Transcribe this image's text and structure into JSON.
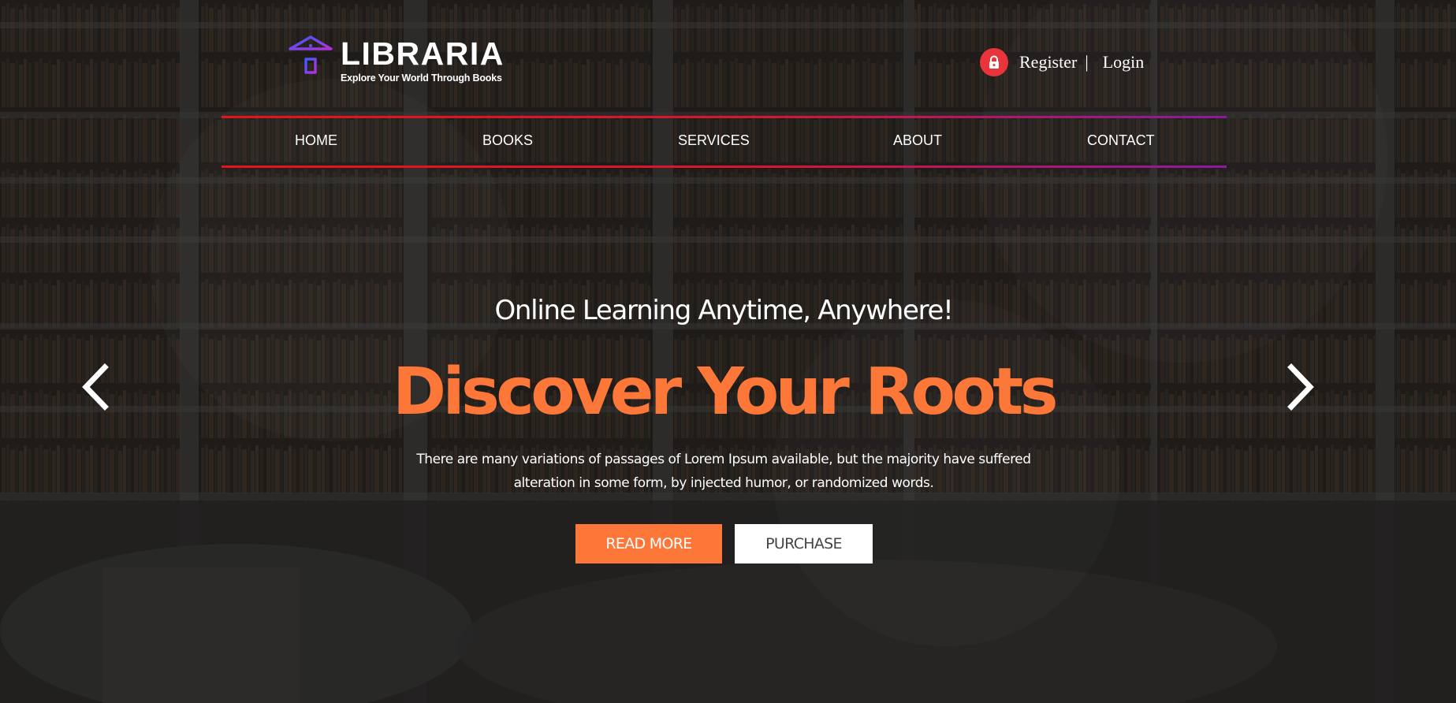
{
  "brand": {
    "name": "LIBRARIA",
    "tagline": "Explore Your World Through Books",
    "logo_icon": "library-building-icon"
  },
  "account": {
    "icon": "lock-icon",
    "register_label": "Register",
    "separator": "|",
    "login_label": "Login"
  },
  "nav": {
    "items": [
      {
        "label": "HOME"
      },
      {
        "label": "BOOKS"
      },
      {
        "label": "SERVICES"
      },
      {
        "label": "ABOUT"
      },
      {
        "label": "CONTACT"
      }
    ]
  },
  "hero": {
    "subtitle": "Online Learning Anytime, Anywhere!",
    "title": "Discover Your Roots",
    "description": "There are many variations of passages of Lorem Ipsum available, but the majority have suffered alteration in some form, by injected humor, or randomized words.",
    "primary_button": "READ MORE",
    "secondary_button": "PURCHASE",
    "prev_icon": "chevron-left-icon",
    "next_icon": "chevron-right-icon"
  },
  "colors": {
    "accent": "#fd7838",
    "nav_line_start": "#e3151b",
    "nav_line_end": "#8c18a0",
    "lock_badge": "#e8343a",
    "logo_gradient_start": "#3b5bff",
    "logo_gradient_end": "#b331d6"
  }
}
